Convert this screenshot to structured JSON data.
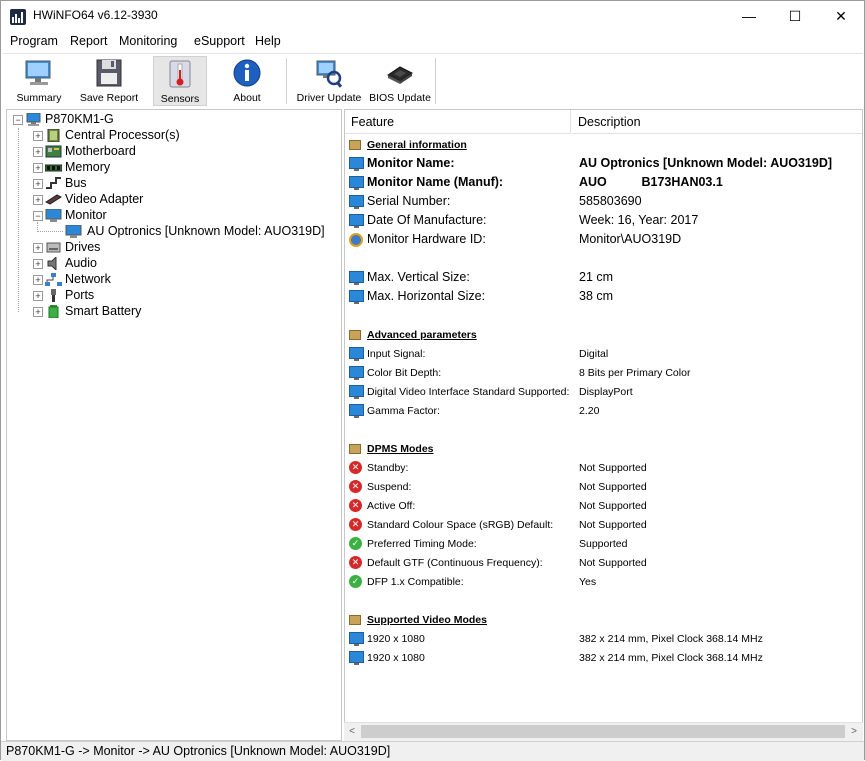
{
  "window": {
    "title": "HWiNFO64 v6.12-3930",
    "minimize": "—",
    "maximize": "☐",
    "close": "✕"
  },
  "menu": [
    "Program",
    "Report",
    "Monitoring",
    "eSupport",
    "Help"
  ],
  "toolbar": [
    {
      "label": "Summary",
      "icon": "monitor-icon"
    },
    {
      "label": "Save Report",
      "icon": "floppy-icon"
    },
    {
      "label": "Sensors",
      "icon": "thermometer-icon"
    },
    {
      "label": "About",
      "icon": "info-icon"
    },
    {
      "label": "Driver Update",
      "icon": "driver-update-icon"
    },
    {
      "label": "BIOS Update",
      "icon": "chip-icon"
    }
  ],
  "tree": {
    "root": "P870KM1-G",
    "items": [
      {
        "label": "Central Processor(s)",
        "icon": "cpu-icon",
        "expander": "+"
      },
      {
        "label": "Motherboard",
        "icon": "motherboard-icon",
        "expander": "+"
      },
      {
        "label": "Memory",
        "icon": "memory-icon",
        "expander": "+"
      },
      {
        "label": "Bus",
        "icon": "bus-icon",
        "expander": "+"
      },
      {
        "label": "Video Adapter",
        "icon": "video-adapter-icon",
        "expander": "+"
      },
      {
        "label": "Monitor",
        "icon": "monitor-icon",
        "expander": "−"
      },
      {
        "label": "Drives",
        "icon": "drive-icon",
        "expander": "+"
      },
      {
        "label": "Audio",
        "icon": "audio-icon",
        "expander": "+"
      },
      {
        "label": "Network",
        "icon": "network-icon",
        "expander": "+"
      },
      {
        "label": "Ports",
        "icon": "port-icon",
        "expander": "+"
      },
      {
        "label": "Smart Battery",
        "icon": "battery-icon",
        "expander": "+"
      }
    ],
    "monitor_child": "AU Optronics [Unknown Model: AUO319D]"
  },
  "detail": {
    "col_feature": "Feature",
    "col_description": "Description",
    "general": {
      "section": "General information",
      "rows": [
        {
          "feature": "Monitor Name:",
          "value": "AU Optronics [Unknown Model: AUO319D]",
          "icon": "monitor"
        },
        {
          "feature": "Monitor Name (Manuf):",
          "value": "AUO          B173HAN03.1",
          "icon": "monitor"
        },
        {
          "feature": "Serial Number:",
          "value": "585803690",
          "icon": "monitor"
        },
        {
          "feature": "Date Of Manufacture:",
          "value": "Week: 16, Year: 2017",
          "icon": "monitor"
        },
        {
          "feature": "Monitor Hardware ID:",
          "value": "Monitor\\AUO319D",
          "icon": "gear"
        },
        {
          "feature": "Max. Vertical Size:",
          "value": "21 cm",
          "icon": "monitor"
        },
        {
          "feature": "Max. Horizontal Size:",
          "value": "38 cm",
          "icon": "monitor"
        }
      ]
    },
    "advanced": {
      "section": "Advanced parameters",
      "rows": [
        {
          "feature": "Input Signal:",
          "value": "Digital"
        },
        {
          "feature": "Color Bit Depth:",
          "value": "8 Bits per Primary Color"
        },
        {
          "feature": "Digital Video Interface Standard Supported:",
          "value": "DisplayPort"
        },
        {
          "feature": "Gamma Factor:",
          "value": "2.20"
        }
      ]
    },
    "dpms": {
      "section": "DPMS Modes",
      "rows": [
        {
          "feature": "Standby:",
          "value": "Not Supported",
          "status": "error"
        },
        {
          "feature": "Suspend:",
          "value": "Not Supported",
          "status": "error"
        },
        {
          "feature": "Active Off:",
          "value": "Not Supported",
          "status": "error"
        },
        {
          "feature": "Standard Colour Space (sRGB) Default:",
          "value": "Not Supported",
          "status": "error"
        },
        {
          "feature": "Preferred Timing Mode:",
          "value": "Supported",
          "status": "ok"
        },
        {
          "feature": "Default GTF (Continuous Frequency):",
          "value": "Not Supported",
          "status": "error"
        },
        {
          "feature": "DFP 1.x Compatible:",
          "value": "Yes",
          "status": "ok"
        }
      ]
    },
    "video_modes": {
      "section": "Supported Video Modes",
      "rows": [
        {
          "feature": "1920 x 1080",
          "value": "382 x 214 mm, Pixel Clock 368.14 MHz"
        },
        {
          "feature": "1920 x 1080",
          "value": "382 x 214 mm, Pixel Clock 368.14 MHz"
        }
      ]
    }
  },
  "scrollbar": {
    "left_arrow": "<",
    "right_arrow": ">"
  },
  "status_text": "P870KM1-G -> Monitor -> AU Optronics [Unknown Model: AUO319D]",
  "colors": {
    "accent": "#2b88d9",
    "error": "#d42a2a",
    "ok": "#3cb043"
  }
}
